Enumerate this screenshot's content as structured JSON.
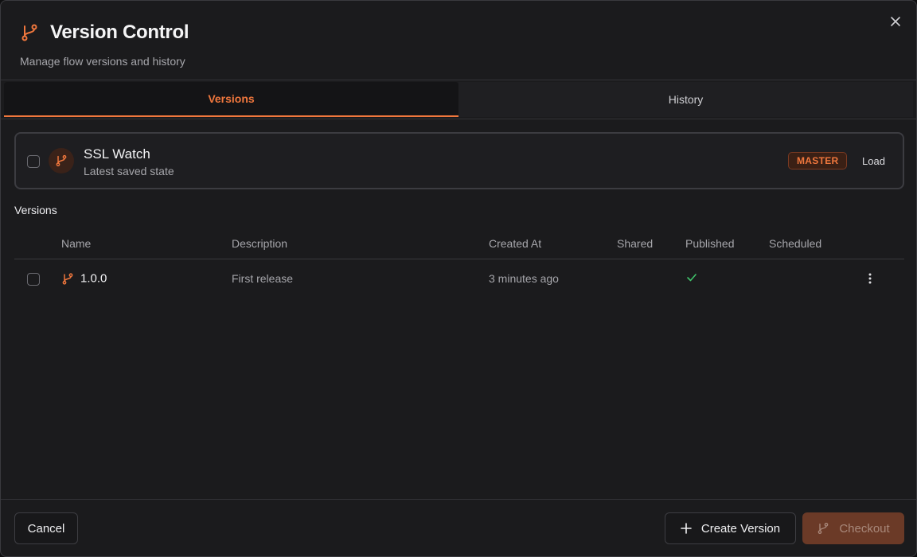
{
  "dialog": {
    "title": "Version Control",
    "subtitle": "Manage flow versions and history",
    "close_icon": "close-icon"
  },
  "tabs": [
    {
      "label": "Versions",
      "active": true
    },
    {
      "label": "History",
      "active": false
    }
  ],
  "master": {
    "name": "SSL Watch",
    "subtitle": "Latest saved state",
    "tag": "MASTER",
    "load_label": "Load",
    "checked": false
  },
  "versions_section": {
    "label": "Versions",
    "columns": [
      "Name",
      "Description",
      "Created At",
      "Shared",
      "Published",
      "Scheduled"
    ],
    "rows": [
      {
        "name": "1.0.0",
        "description": "First release",
        "created_at": "3 minutes ago",
        "shared": false,
        "published": true,
        "scheduled": false
      }
    ]
  },
  "footer": {
    "cancel_label": "Cancel",
    "create_label": "Create Version",
    "checkout_label": "Checkout"
  },
  "colors": {
    "accent": "#f0773d",
    "check_green": "#3fc26a",
    "background": "#1b1b1d"
  }
}
